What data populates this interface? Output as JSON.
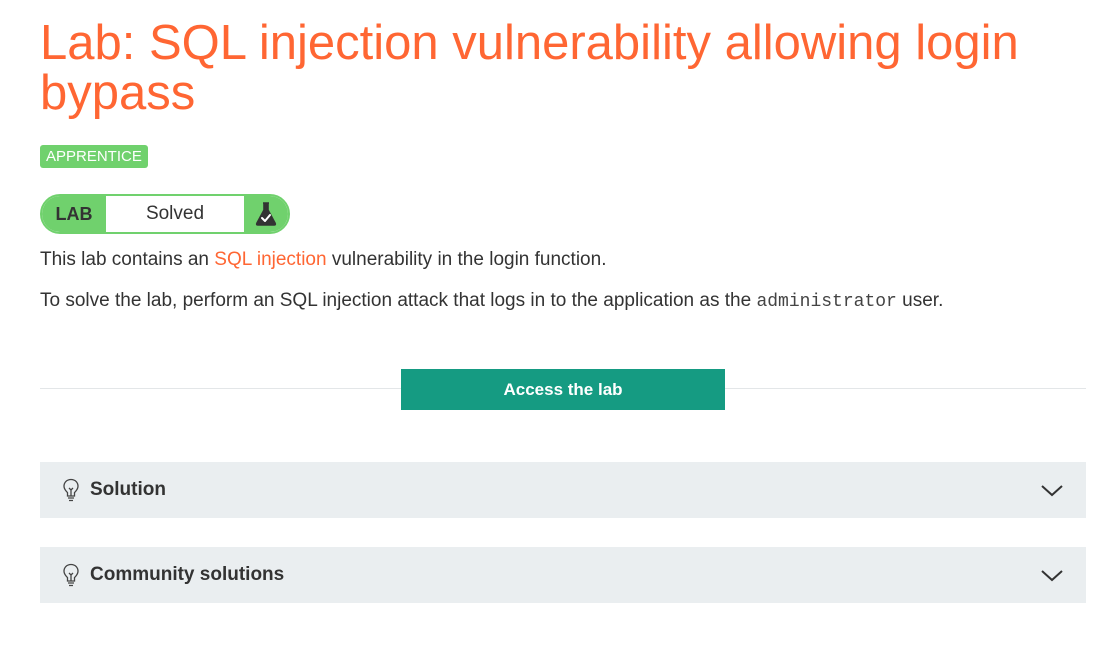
{
  "lab": {
    "title": "Lab: SQL injection vulnerability allowing login bypass",
    "level_badge": "APPRENTICE",
    "status": {
      "lab_label": "LAB",
      "status_text": "Solved",
      "icon": "flask-solved-icon"
    },
    "description": {
      "p1_before": "This lab contains an ",
      "p1_link": "SQL injection",
      "p1_after": " vulnerability in the login function.",
      "p2_before": "To solve the lab, perform an SQL injection attack that logs in to the application as the ",
      "p2_code": "administrator",
      "p2_after": " user."
    },
    "access_button": "Access the lab"
  },
  "accordions": [
    {
      "label": "Solution",
      "icon": "lightbulb-icon",
      "expand_icon": "chevron-down-icon"
    },
    {
      "label": "Community solutions",
      "icon": "lightbulb-icon",
      "expand_icon": "chevron-down-icon"
    }
  ],
  "colors": {
    "title": "#ff6633",
    "badge_green": "#70d16d",
    "button_teal": "#159b82",
    "accordion_bg": "#eaeef0"
  }
}
